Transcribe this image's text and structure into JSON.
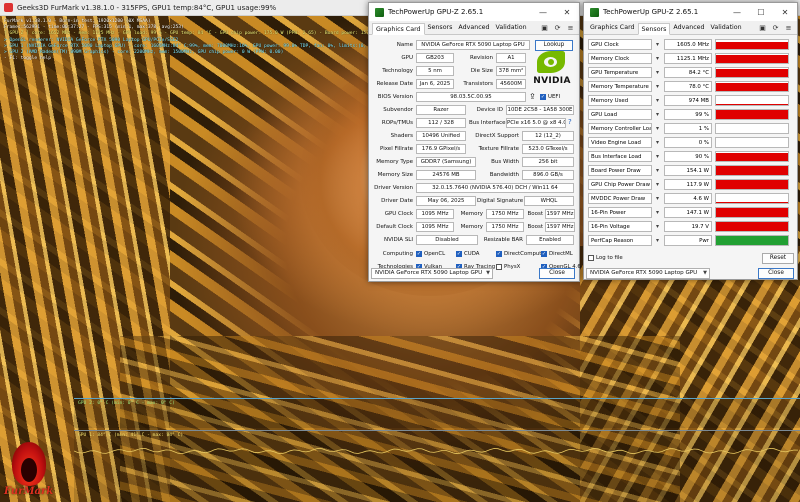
{
  "furmark": {
    "window_title": "Geeks3D FurMark v1.38.1.0 - 315FPS, GPU1 temp:84°C, GPU1 usage:99%",
    "info_lines": [
      {
        "text": "FurMark v1.38.1.0 - Burn-in test, 1920x1200 (0X MSAA)",
        "color": "white"
      },
      {
        "text": "Frames:562991 - time:00:37:27 - FPS:315 (min:1, max:378, avg:253)",
        "color": "white"
      },
      {
        "text": "[ GPU-Z ] core: 1652 MHz - mem: 1125 MHz - GPU load: 99 % - GPU temp: 84 °C - GPU chip power: 175.0 W (PPW: 2.65) - Board power: 157.1 W (PPW: 2.00) - GPU voltage: 0.915 V",
        "color": "yellow"
      },
      {
        "text": "> OpenGL renderer: NVIDIA GeForce RTX 5090 Laptop GPU/PCIe/SSE2",
        "color": "cyan"
      },
      {
        "text": "> GPU 1 (NVIDIA GeForce RTX 5090 Laptop GPU) - core: 1605MHz:84° C:99%, mem: 7000MHz:16%, GPU power: 99.0% TDP, fan: 0%, limits:(0, fw:0, util:0, OV:0)",
        "color": "cyan"
      },
      {
        "text": "> GPU 2 (AMD Radeon(TM) 890M Graphics) - core: 2200MHz, mem: 1500MHz, GPU chip power: 0 W (PPW: 0.00)",
        "color": "cyan"
      },
      {
        "text": "- F1: toggle help",
        "color": "white"
      }
    ],
    "graph1_label": "GPU 2: 0° C (min: 0° C - max: 0° C)",
    "graph2_label": "GPU 1: 84° C (min: 41° C - max: 84° C)",
    "logo_text": "FurMark"
  },
  "gpuz_card": {
    "title": "TechPowerUp GPU-Z 2.65.1",
    "tabs": [
      "Graphics Card",
      "Sensors",
      "Advanced",
      "Validation"
    ],
    "active_tab": 0,
    "labels": {
      "name": "Name",
      "gpu": "GPU",
      "revision": "Revision",
      "technology": "Technology",
      "die_size": "Die Size",
      "release_date": "Release Date",
      "transistors": "Transistors",
      "bios": "BIOS Version",
      "subvendor": "Subvendor",
      "device_id": "Device ID",
      "rops": "ROPs/TMUs",
      "bus_interface": "Bus Interface",
      "shaders": "Shaders",
      "directx": "DirectX Support",
      "pixel_fillrate": "Pixel Fillrate",
      "texture_fillrate": "Texture Fillrate",
      "memory_type": "Memory Type",
      "bus_width": "Bus Width",
      "memory_size": "Memory Size",
      "bandwidth": "Bandwidth",
      "driver_version": "Driver Version",
      "driver_date": "Driver Date",
      "digital_signature": "Digital Signature",
      "gpu_clock": "GPU Clock",
      "default_clock": "Default Clock",
      "memory": "Memory",
      "boost": "Boost",
      "sli": "NVIDIA SLI",
      "resizable_bar": "Resizable BAR",
      "computing": "Computing",
      "technologies": "Technologies"
    },
    "values": {
      "name": "NVIDIA GeForce RTX 5090 Laptop GPU",
      "gpu": "GB203",
      "revision": "A1",
      "technology": "5 nm",
      "die_size": "378 mm²",
      "release_date": "Jan 6, 2025",
      "transistors": "45600M",
      "bios": "98.03.5C.00.95",
      "subvendor": "Razer",
      "device_id": "10DE 2C58 - 1A58 300E",
      "rops": "112 / 328",
      "bus_interface": "PCIe x16 5.0 @ x8 4.0",
      "shaders": "10496 Unified",
      "directx": "12 (12_2)",
      "pixel_fillrate": "176.9 GPixel/s",
      "texture_fillrate": "523.0 GTexel/s",
      "memory_type": "GDDR7 (Samsung)",
      "bus_width": "256 bit",
      "memory_size": "24576 MB",
      "bandwidth": "896.0 GB/s",
      "driver_version": "32.0.15.7640 (NVIDIA 576.40) DCH / Win11 64",
      "driver_date": "May 06, 2025",
      "digital_signature": "WHQL",
      "gpu_clock": "1095 MHz",
      "gpu_mem": "1750 MHz",
      "gpu_boost": "1597 MHz",
      "default_clock": "1095 MHz",
      "default_mem": "1750 MHz",
      "default_boost": "1597 MHz",
      "sli": "Disabled",
      "resizable_bar": "Enabled"
    },
    "lookup_label": "Lookup",
    "uefi_label": "UEFI",
    "computing": [
      {
        "label": "OpenCL",
        "checked": true
      },
      {
        "label": "CUDA",
        "checked": true
      },
      {
        "label": "DirectCompute",
        "checked": true
      },
      {
        "label": "DirectML",
        "checked": true
      }
    ],
    "technologies": [
      {
        "label": "Vulkan",
        "checked": true
      },
      {
        "label": "Ray Tracing",
        "checked": true
      },
      {
        "label": "PhysX",
        "checked": false
      },
      {
        "label": "OpenGL 4.6",
        "checked": true
      }
    ],
    "gpu_select": "NVIDIA GeForce RTX 5090 Laptop GPU",
    "close_label": "Close",
    "nvidia_word": "NVIDIA",
    "accent_green": "#76b900"
  },
  "gpuz_sensors": {
    "title": "TechPowerUp GPU-Z 2.65.1",
    "tabs": [
      "Graphics Card",
      "Sensors",
      "Advanced",
      "Validation"
    ],
    "active_tab": 1,
    "sensors": [
      {
        "name": "GPU Clock",
        "value": "1605.0 MHz",
        "level": 0.75,
        "color": "#e00000"
      },
      {
        "name": "Memory Clock",
        "value": "1125.1 MHz",
        "level": 0.9,
        "color": "#e00000"
      },
      {
        "name": "GPU Temperature",
        "value": "84.2 °C",
        "level": 0.85,
        "color": "#e00000"
      },
      {
        "name": "Memory Temperature",
        "value": "78.0 °C",
        "level": 0.9,
        "color": "#e00000"
      },
      {
        "name": "Memory Used",
        "value": "974 MB",
        "level": 0.06,
        "color": "#e00000"
      },
      {
        "name": "GPU Load",
        "value": "99 %",
        "level": 0.97,
        "color": "#e00000"
      },
      {
        "name": "Memory Controller Load",
        "value": "1 %",
        "level": 0.0,
        "color": "#e00000"
      },
      {
        "name": "Video Engine Load",
        "value": "0 %",
        "level": 0.0,
        "color": "#e00000"
      },
      {
        "name": "Bus Interface Load",
        "value": "90 %",
        "level": 0.9,
        "color": "#e00000"
      },
      {
        "name": "Board Power Draw",
        "value": "154.1 W",
        "level": 0.95,
        "color": "#e00000"
      },
      {
        "name": "GPU Chip Power Draw",
        "value": "117.9 W",
        "level": 0.95,
        "color": "#e00000"
      },
      {
        "name": "MVDDC Power Draw",
        "value": "4.6 W",
        "level": 0.06,
        "color": "#e00000"
      },
      {
        "name": "16-Pin Power",
        "value": "147.1 W",
        "level": 0.95,
        "color": "#e00000"
      },
      {
        "name": "16-Pin Voltage",
        "value": "19.7 V",
        "level": 0.95,
        "color": "#e00000"
      },
      {
        "name": "PerfCap Reason",
        "value": "Pwr",
        "level": 1.0,
        "color": "#22a033"
      }
    ],
    "log_label": "Log to file",
    "reset_label": "Reset",
    "gpu_select": "NVIDIA GeForce RTX 5090 Laptop GPU",
    "close_label": "Close"
  }
}
